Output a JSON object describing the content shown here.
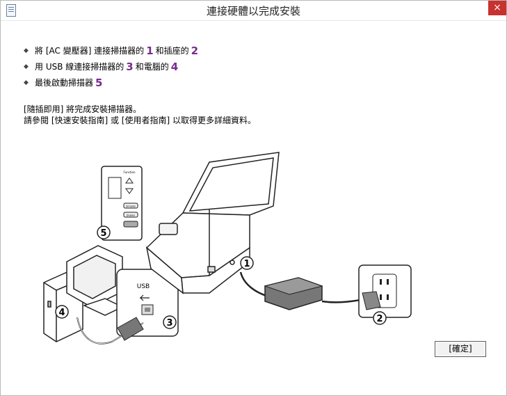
{
  "window": {
    "title": "連接硬體以完成安裝",
    "close_glyph": "×"
  },
  "steps": [
    {
      "before": "將 [AC 變壓器] 連接掃描器的",
      "num1": "1",
      "mid": "和插座的",
      "num2": "2"
    },
    {
      "before": "用 USB 線連接掃描器的",
      "num1": "3",
      "mid": "和電腦的",
      "num2": "4"
    },
    {
      "before": "最後啟動掃描器",
      "num1": "5"
    }
  ],
  "info": {
    "line1": "[隨插即用] 將完成安裝掃描器。",
    "line2": "請參閱 [快速安裝指南] 或 [使用者指南] 以取得更多詳細資料。"
  },
  "illustration": {
    "callouts": [
      "1",
      "2",
      "3",
      "4",
      "5"
    ],
    "usb_label": "USB",
    "panel_button_labels": [
      "Function",
      "Simplex",
      "Duplex"
    ]
  },
  "buttons": {
    "ok": "[確定]"
  },
  "colors": {
    "accent": "#7a2a8e",
    "close_bg": "#c7312f"
  }
}
